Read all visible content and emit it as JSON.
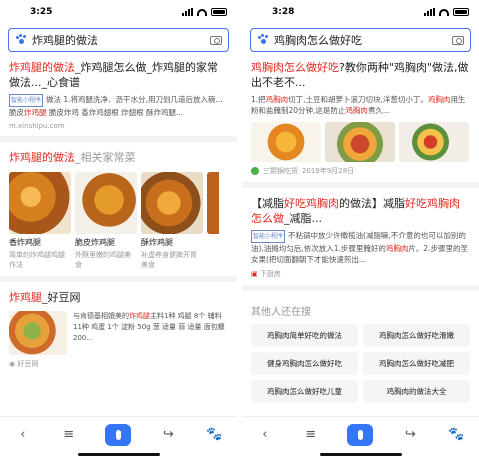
{
  "left": {
    "status": {
      "time": "3:25"
    },
    "search": {
      "query": "炸鸡腿的做法"
    },
    "result1": {
      "title_red": "炸鸡腿的做法",
      "title_rest": "_炸鸡腿怎么做_炸鸡腿的家常做法..._心食谱",
      "tag": "智能小程序",
      "snippet_a": "做法 1.将鸡腿洗净、沥干水分,用刀划几道后放入碗...脆皮",
      "snippet_red": "炸鸡腿",
      "snippet_b": " 脆皮炸鸡 香炸鸡翅根 炸翅根 酥炸鸡腿...",
      "source": "m.xinshipu.com"
    },
    "result2": {
      "title_red": "炸鸡腿的做法",
      "title_sub": "_相关家常菜",
      "dishes": [
        {
          "name": "香炸鸡腿",
          "desc": "简单的炸鸡腿鸡腿作法"
        },
        {
          "name": "脆皮炸鸡腿",
          "desc": "外酥里嫩的鸡腿美食"
        },
        {
          "name": "酥炸鸡腿",
          "desc": "补虚养身健脾开胃美食"
        }
      ]
    },
    "result3": {
      "title_red": "炸鸡腿",
      "title_rest": "_好豆网",
      "text_a": "与肯德基相媲美的",
      "text_red": "炸鸡腿",
      "text_b": "主料1种 鸡腿 8个 辅料11种 鸡蛋 1个 淀粉 50g 葱 适量 蒜 适量 面包糠 200...",
      "source": "好豆网"
    }
  },
  "right": {
    "status": {
      "time": "3:28"
    },
    "search": {
      "query": "鸡胸肉怎么做好吃"
    },
    "result1": {
      "title_red": "鸡胸肉怎么做好吃",
      "title_rest": "?教你两种\"鸡胸肉\"做法,做出不老不...",
      "snippet_a": "1.把",
      "snippet_red1": "鸡胸肉",
      "snippet_b": "切丁,土豆和胡萝卜滚刀切块,洋葱切小丁。",
      "snippet_red2": "鸡胸肉",
      "snippet_c": "用生粉和盐腌制20分钟,这是防止",
      "snippet_red3": "鸡胸肉",
      "snippet_d": "煮久...",
      "meta_source": "三颗锅吃货",
      "meta_date": "2018年9月28日"
    },
    "result2": {
      "title_a": "【减脂",
      "title_red1": "好吃鸡胸肉",
      "title_b": "的做法】减脂",
      "title_red2": "好吃鸡胸肉怎么做",
      "title_c": "_减脂...",
      "tag": "智能小程序",
      "snippet_a": "不粘锅中放少许橄榄油(减脂嘛,不介意的也可以加别的油),油摊均匀后,依次放入1.步骤里腌好的",
      "snippet_red": "鸡胸肉",
      "snippet_b": "片。2.步骤里的圣女果(把切面翻朝下才能快速煎出...",
      "source": "下厨房"
    },
    "others": {
      "title": "其他人还在搜",
      "chips": [
        "鸡胸肉简单好吃的做法",
        "鸡胸肉怎么做好吃滑嫩",
        "健身鸡胸肉怎么做好吃",
        "鸡胸肉怎么做好吃减肥",
        "鸡胸肉怎么做好吃儿童",
        "鸡胸肉的做法大全"
      ]
    }
  },
  "nav": {
    "back": "‹",
    "menu": "≡",
    "share": "↪",
    "paw": "🐾"
  }
}
